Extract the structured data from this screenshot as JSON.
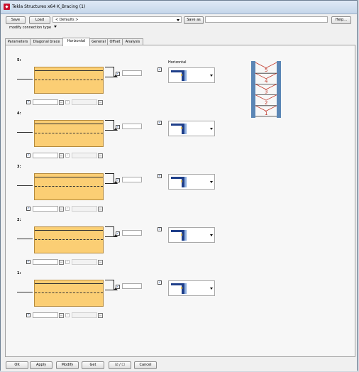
{
  "window": {
    "title": "Tekla Structures x64  K_Bracing (1)"
  },
  "toolbar": {
    "save_label": "Save",
    "load_label": "Load",
    "preset_value": "< Defaults >",
    "save_as_label": "Save as",
    "save_as_value": "",
    "help_label": "Help..."
  },
  "mode": {
    "value": "modify connection type"
  },
  "tabs": [
    "Parameters",
    "Diagonal brace",
    "Horizontal",
    "General",
    "Offset",
    "Analysis"
  ],
  "active_tab": "Horizontal",
  "horizontal_header": "Horizontal",
  "rows": [
    {
      "label": "5:"
    },
    {
      "label": "4:"
    },
    {
      "label": "3:"
    },
    {
      "label": "2:"
    },
    {
      "label": "1:"
    }
  ],
  "preview": {
    "levels": [
      "5",
      "4",
      "3",
      "2",
      "1"
    ],
    "column_color": "#5b86b5",
    "brace_color": "#c0392b"
  },
  "footer": {
    "ok_label": "OK",
    "apply_label": "Apply",
    "modify_label": "Modify",
    "get_label": "Get",
    "toggle_label": "☑ / ☐",
    "cancel_label": "Cancel"
  },
  "colors": {
    "profile_fill": "#fbce74",
    "check_mark": "#1f4fa6"
  }
}
